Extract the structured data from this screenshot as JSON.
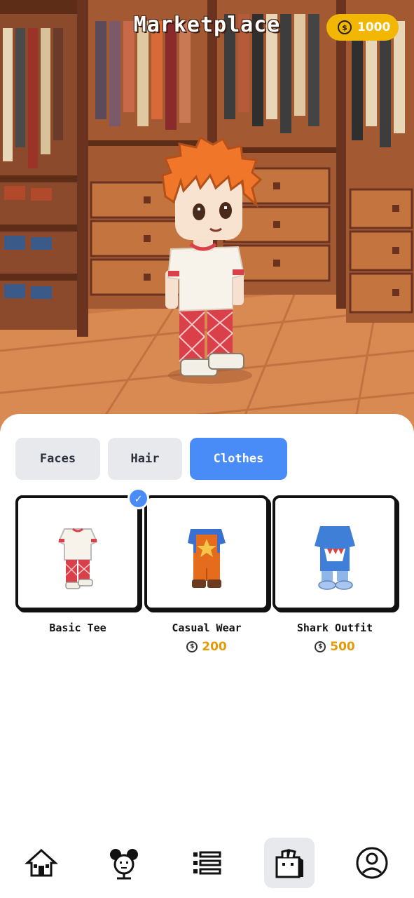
{
  "header": {
    "title": "Marketplace",
    "coins": "1000"
  },
  "tabs": [
    {
      "label": "Faces",
      "active": false
    },
    {
      "label": "Hair",
      "active": false
    },
    {
      "label": "Clothes",
      "active": true
    }
  ],
  "items": [
    {
      "name": "Basic Tee",
      "price": "",
      "owned": true,
      "selected": true
    },
    {
      "name": "Casual Wear",
      "price": "200",
      "owned": false,
      "selected": false
    },
    {
      "name": "Shark Outfit",
      "price": "500",
      "owned": false,
      "selected": false
    }
  ],
  "nav": [
    {
      "icon": "house-icon",
      "active": false
    },
    {
      "icon": "character-icon",
      "active": false
    },
    {
      "icon": "list-icon",
      "active": false
    },
    {
      "icon": "shopping-bag-icon",
      "active": true
    },
    {
      "icon": "profile-icon",
      "active": false
    }
  ],
  "colors": {
    "accent": "#4a8cf7",
    "coin": "#f2b705",
    "price": "#e29a08",
    "tab_inactive": "#e7e9ed"
  }
}
